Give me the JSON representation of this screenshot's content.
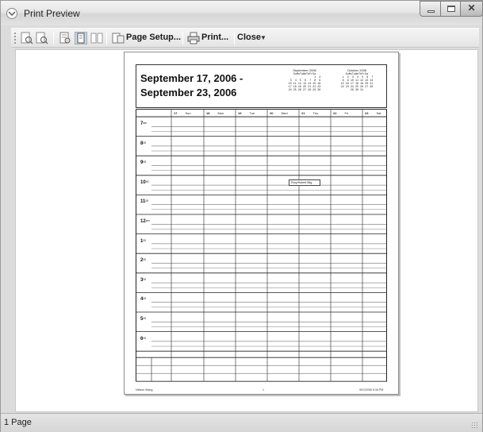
{
  "window": {
    "title": "Print Preview"
  },
  "toolbar": {
    "page_setup_label": "Page Setup...",
    "print_label": "Print...",
    "close_label": "Close"
  },
  "document": {
    "title_line1": "September 17, 2006 -",
    "title_line2": "September 23, 2006",
    "minical_left": {
      "title": "September 2006",
      "header": "SuMoTuWeThFrSa",
      "rows": [
        "                1  2",
        " 3  4  5  6  7  8  9",
        "10 11 12 13 14 15 16",
        "17 18 19 20 21 22 23",
        "24 25 26 27 28 29 30"
      ]
    },
    "minical_right": {
      "title": "October 2006",
      "header": "SuMoTuWeThFrSa",
      "rows": [
        " 1  2  3  4  5  6  7",
        " 8  9 10 11 12 13 14",
        "15 16 17 18 19 20 21",
        "22 23 24 25 26 27 28",
        "29 30 31"
      ]
    },
    "days": [
      {
        "num": "17",
        "name": "Sun"
      },
      {
        "num": "18",
        "name": "Mon"
      },
      {
        "num": "19",
        "name": "Tue"
      },
      {
        "num": "20",
        "name": "Wed"
      },
      {
        "num": "21",
        "name": "Thu"
      },
      {
        "num": "22",
        "name": "Fri"
      },
      {
        "num": "23",
        "name": "Sat"
      }
    ],
    "hours": [
      {
        "h": "7",
        "s": "am"
      },
      {
        "h": "8",
        "s": "00"
      },
      {
        "h": "9",
        "s": "00"
      },
      {
        "h": "10",
        "s": "00"
      },
      {
        "h": "11",
        "s": "00"
      },
      {
        "h": "12",
        "s": "pm"
      },
      {
        "h": "1",
        "s": "00"
      },
      {
        "h": "2",
        "s": "00"
      },
      {
        "h": "3",
        "s": "00"
      },
      {
        "h": "4",
        "s": "00"
      },
      {
        "h": "5",
        "s": "00"
      },
      {
        "h": "6",
        "s": "00"
      }
    ],
    "appointment": "Rory/Hubert Mtg",
    "footer_left": "Nelson Wang",
    "footer_center": "1",
    "footer_right": "9/21/2006 6:34 PM"
  },
  "status": {
    "text": "1 Page"
  }
}
